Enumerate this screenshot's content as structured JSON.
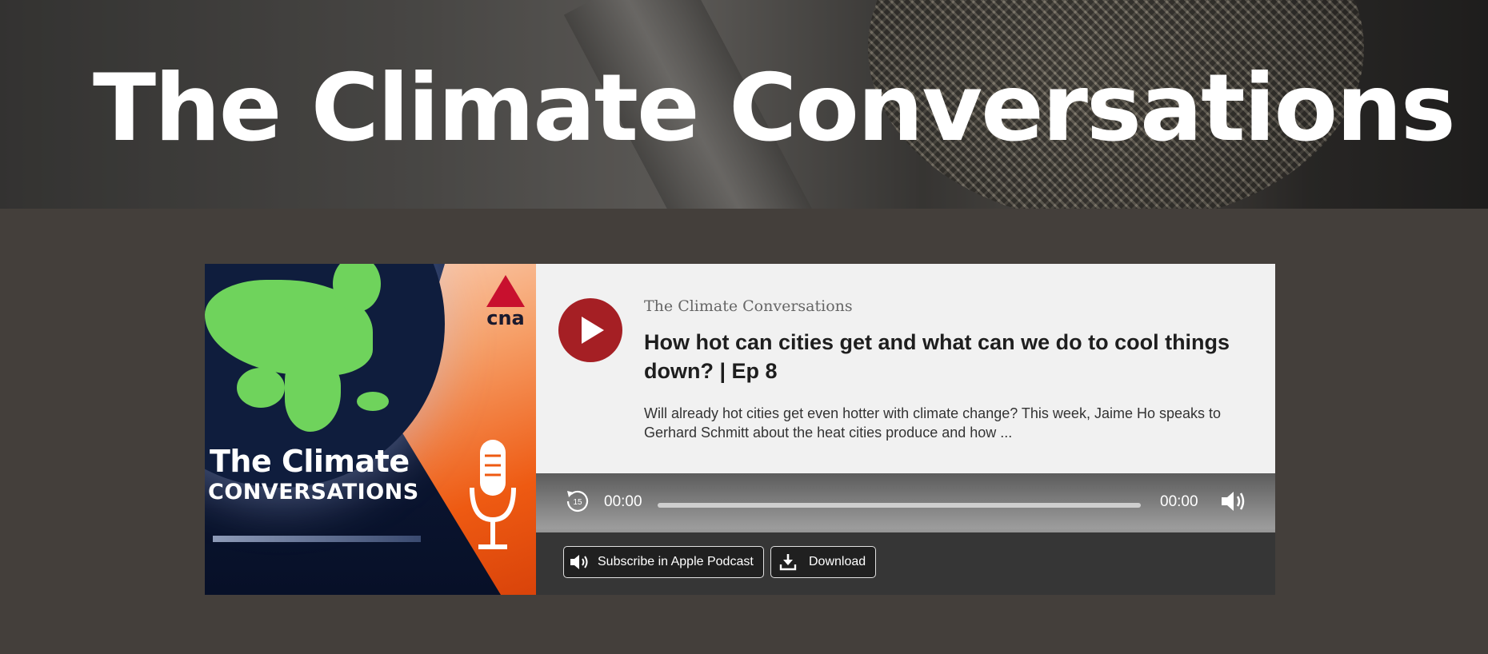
{
  "hero": {
    "title": "The Climate Conversations"
  },
  "artwork": {
    "brand": "cna",
    "title_line1": "The Climate",
    "title_line2": "CONVERSATIONS"
  },
  "episode": {
    "show_name": "The Climate Conversations",
    "title": "How hot can cities get and what can we do to cool things down? | Ep 8",
    "description": "Will already hot cities get even hotter with climate change? This week, Jaime Ho speaks to Gerhard Schmitt about the heat cities produce and how ..."
  },
  "player": {
    "rewind_seconds": "15",
    "current_time": "00:00",
    "duration": "00:00",
    "progress": 0,
    "accent_color": "#a51f24"
  },
  "actions": {
    "subscribe_label": "Subscribe in Apple Podcast",
    "download_label": "Download"
  },
  "icons": [
    "play-icon",
    "rewind-15-icon",
    "volume-icon",
    "speaker-icon",
    "download-icon",
    "microphone-icon"
  ]
}
